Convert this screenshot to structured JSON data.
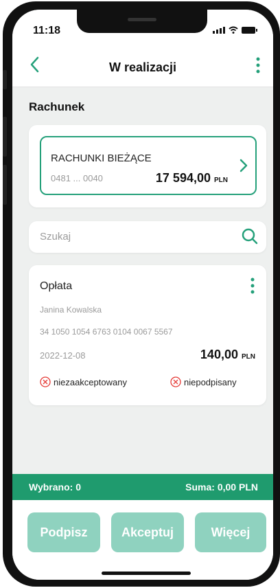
{
  "status_bar": {
    "time": "11:18"
  },
  "header": {
    "title": "W realizacji"
  },
  "section": {
    "label": "Rachunek"
  },
  "account": {
    "name": "RACHUNKI BIEŻĄCE",
    "number": "0481 ... 0040",
    "amount": "17 594,00",
    "currency": "PLN"
  },
  "search": {
    "placeholder": "Szukaj"
  },
  "transaction": {
    "title": "Opłata",
    "recipient": "Janina Kowalska",
    "account_number": "34 1050 1054 6763 0104 0067 5567",
    "date": "2022-12-08",
    "amount": "140,00",
    "currency": "PLN",
    "status_accept": "niezaakceptowany",
    "status_sign": "niepodpisany"
  },
  "summary": {
    "selected": "Wybrano: 0",
    "total": "Suma: 0,00 PLN"
  },
  "buttons": {
    "sign": "Podpisz",
    "accept": "Akceptuj",
    "more": "Więcej"
  },
  "colors": {
    "accent": "#24a07a",
    "footer": "#1f9b6e",
    "button_disabled": "#8fd2bf",
    "status_error": "#e53935"
  }
}
